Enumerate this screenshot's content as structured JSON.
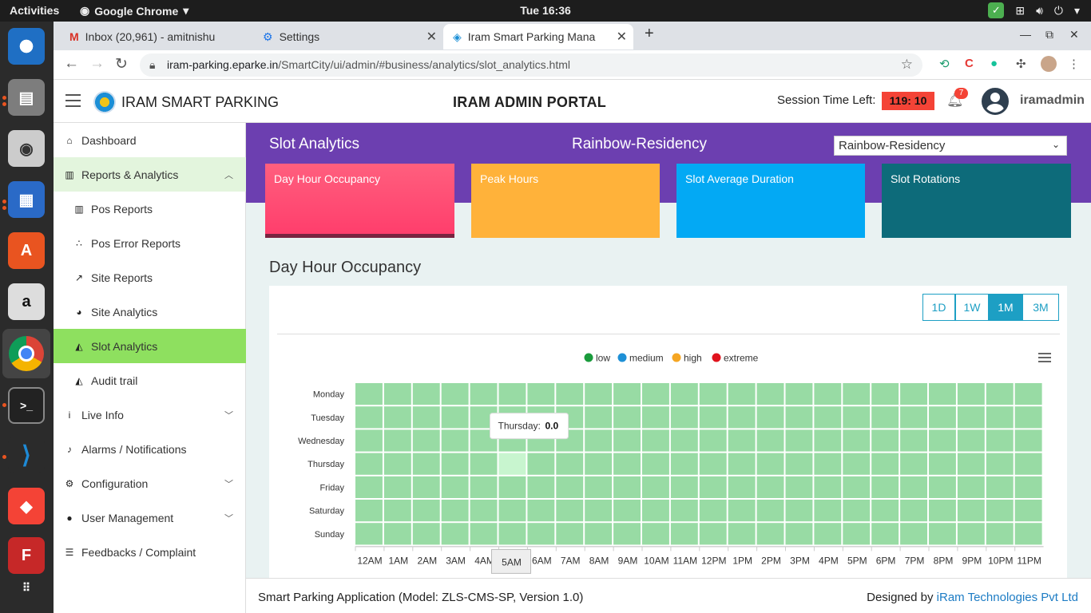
{
  "os": {
    "activities": "Activities",
    "app_name": "Google Chrome",
    "clock": "Tue 16:36"
  },
  "browser": {
    "tabs": [
      {
        "label": "Inbox (20,961) - amitnishu"
      },
      {
        "label": "Settings"
      },
      {
        "label": "Iram Smart Parking Mana"
      }
    ],
    "url_host": "iram-parking.eparke.in",
    "url_path": "/SmartCity/ui/admin/#business/analytics/slot_analytics.html"
  },
  "header": {
    "brand": "IRAM SMART PARKING",
    "portal": "IRAM ADMIN PORTAL",
    "session_label": "Session Time Left:",
    "session_time": "119: 10",
    "notif_count": "7",
    "username": "iramadmin"
  },
  "sidebar": {
    "items": [
      {
        "label": "Dashboard",
        "icon": "home-icon"
      },
      {
        "label": "Reports & Analytics",
        "icon": "bar-chart-icon"
      },
      {
        "label": "Pos Reports",
        "icon": "bar-chart-icon"
      },
      {
        "label": "Pos Error Reports",
        "icon": "scatter-icon"
      },
      {
        "label": "Site Reports",
        "icon": "line-chart-icon"
      },
      {
        "label": "Site Analytics",
        "icon": "pie-chart-icon"
      },
      {
        "label": "Slot Analytics",
        "icon": "area-chart-icon"
      },
      {
        "label": "Audit trail",
        "icon": "area-chart-icon"
      },
      {
        "label": "Live Info",
        "icon": "info-icon"
      },
      {
        "label": "Alarms / Notifications",
        "icon": "bell-icon"
      },
      {
        "label": "Configuration",
        "icon": "gears-icon"
      },
      {
        "label": "User Management",
        "icon": "user-icon"
      },
      {
        "label": "Feedbacks / Complaint",
        "icon": "list-icon"
      }
    ]
  },
  "page": {
    "title": "Slot Analytics",
    "site": "Rainbow-Residency",
    "selected_site": "Rainbow-Residency",
    "cards": [
      "Day Hour Occupancy",
      "Peak Hours",
      "Slot Average Duration",
      "Slot Rotations"
    ],
    "section_title": "Day Hour Occupancy",
    "ranges": [
      "1D",
      "1W",
      "1M",
      "3M"
    ],
    "active_range": "1M"
  },
  "chart_data": {
    "type": "heatmap",
    "legend": [
      {
        "name": "low",
        "color": "#1a9b3c"
      },
      {
        "name": "medium",
        "color": "#1e90d6"
      },
      {
        "name": "high",
        "color": "#f5a623"
      },
      {
        "name": "extreme",
        "color": "#e0131d"
      }
    ],
    "x": [
      "12AM",
      "1AM",
      "2AM",
      "3AM",
      "4AM",
      "5AM",
      "6AM",
      "7AM",
      "8AM",
      "9AM",
      "10AM",
      "11AM",
      "12PM",
      "1PM",
      "2PM",
      "3PM",
      "4PM",
      "5PM",
      "6PM",
      "7PM",
      "8PM",
      "9PM",
      "10PM",
      "11PM"
    ],
    "y": [
      "Monday",
      "Tuesday",
      "Wednesday",
      "Thursday",
      "Friday",
      "Saturday",
      "Sunday"
    ],
    "value_all": 0.0,
    "cell_color": "#98dba4",
    "highlight_color": "#c8f5cf",
    "tooltip": {
      "day": "Thursday",
      "label": "Thursday:",
      "value": "0.0",
      "x_label": "5AM",
      "x_index": 5,
      "y_index": 3
    }
  },
  "footer": {
    "left": "Smart Parking Application (Model: ZLS-CMS-SP, Version 1.0)",
    "designed": "Designed by ",
    "company": "iRam Technologies Pvt Ltd"
  }
}
